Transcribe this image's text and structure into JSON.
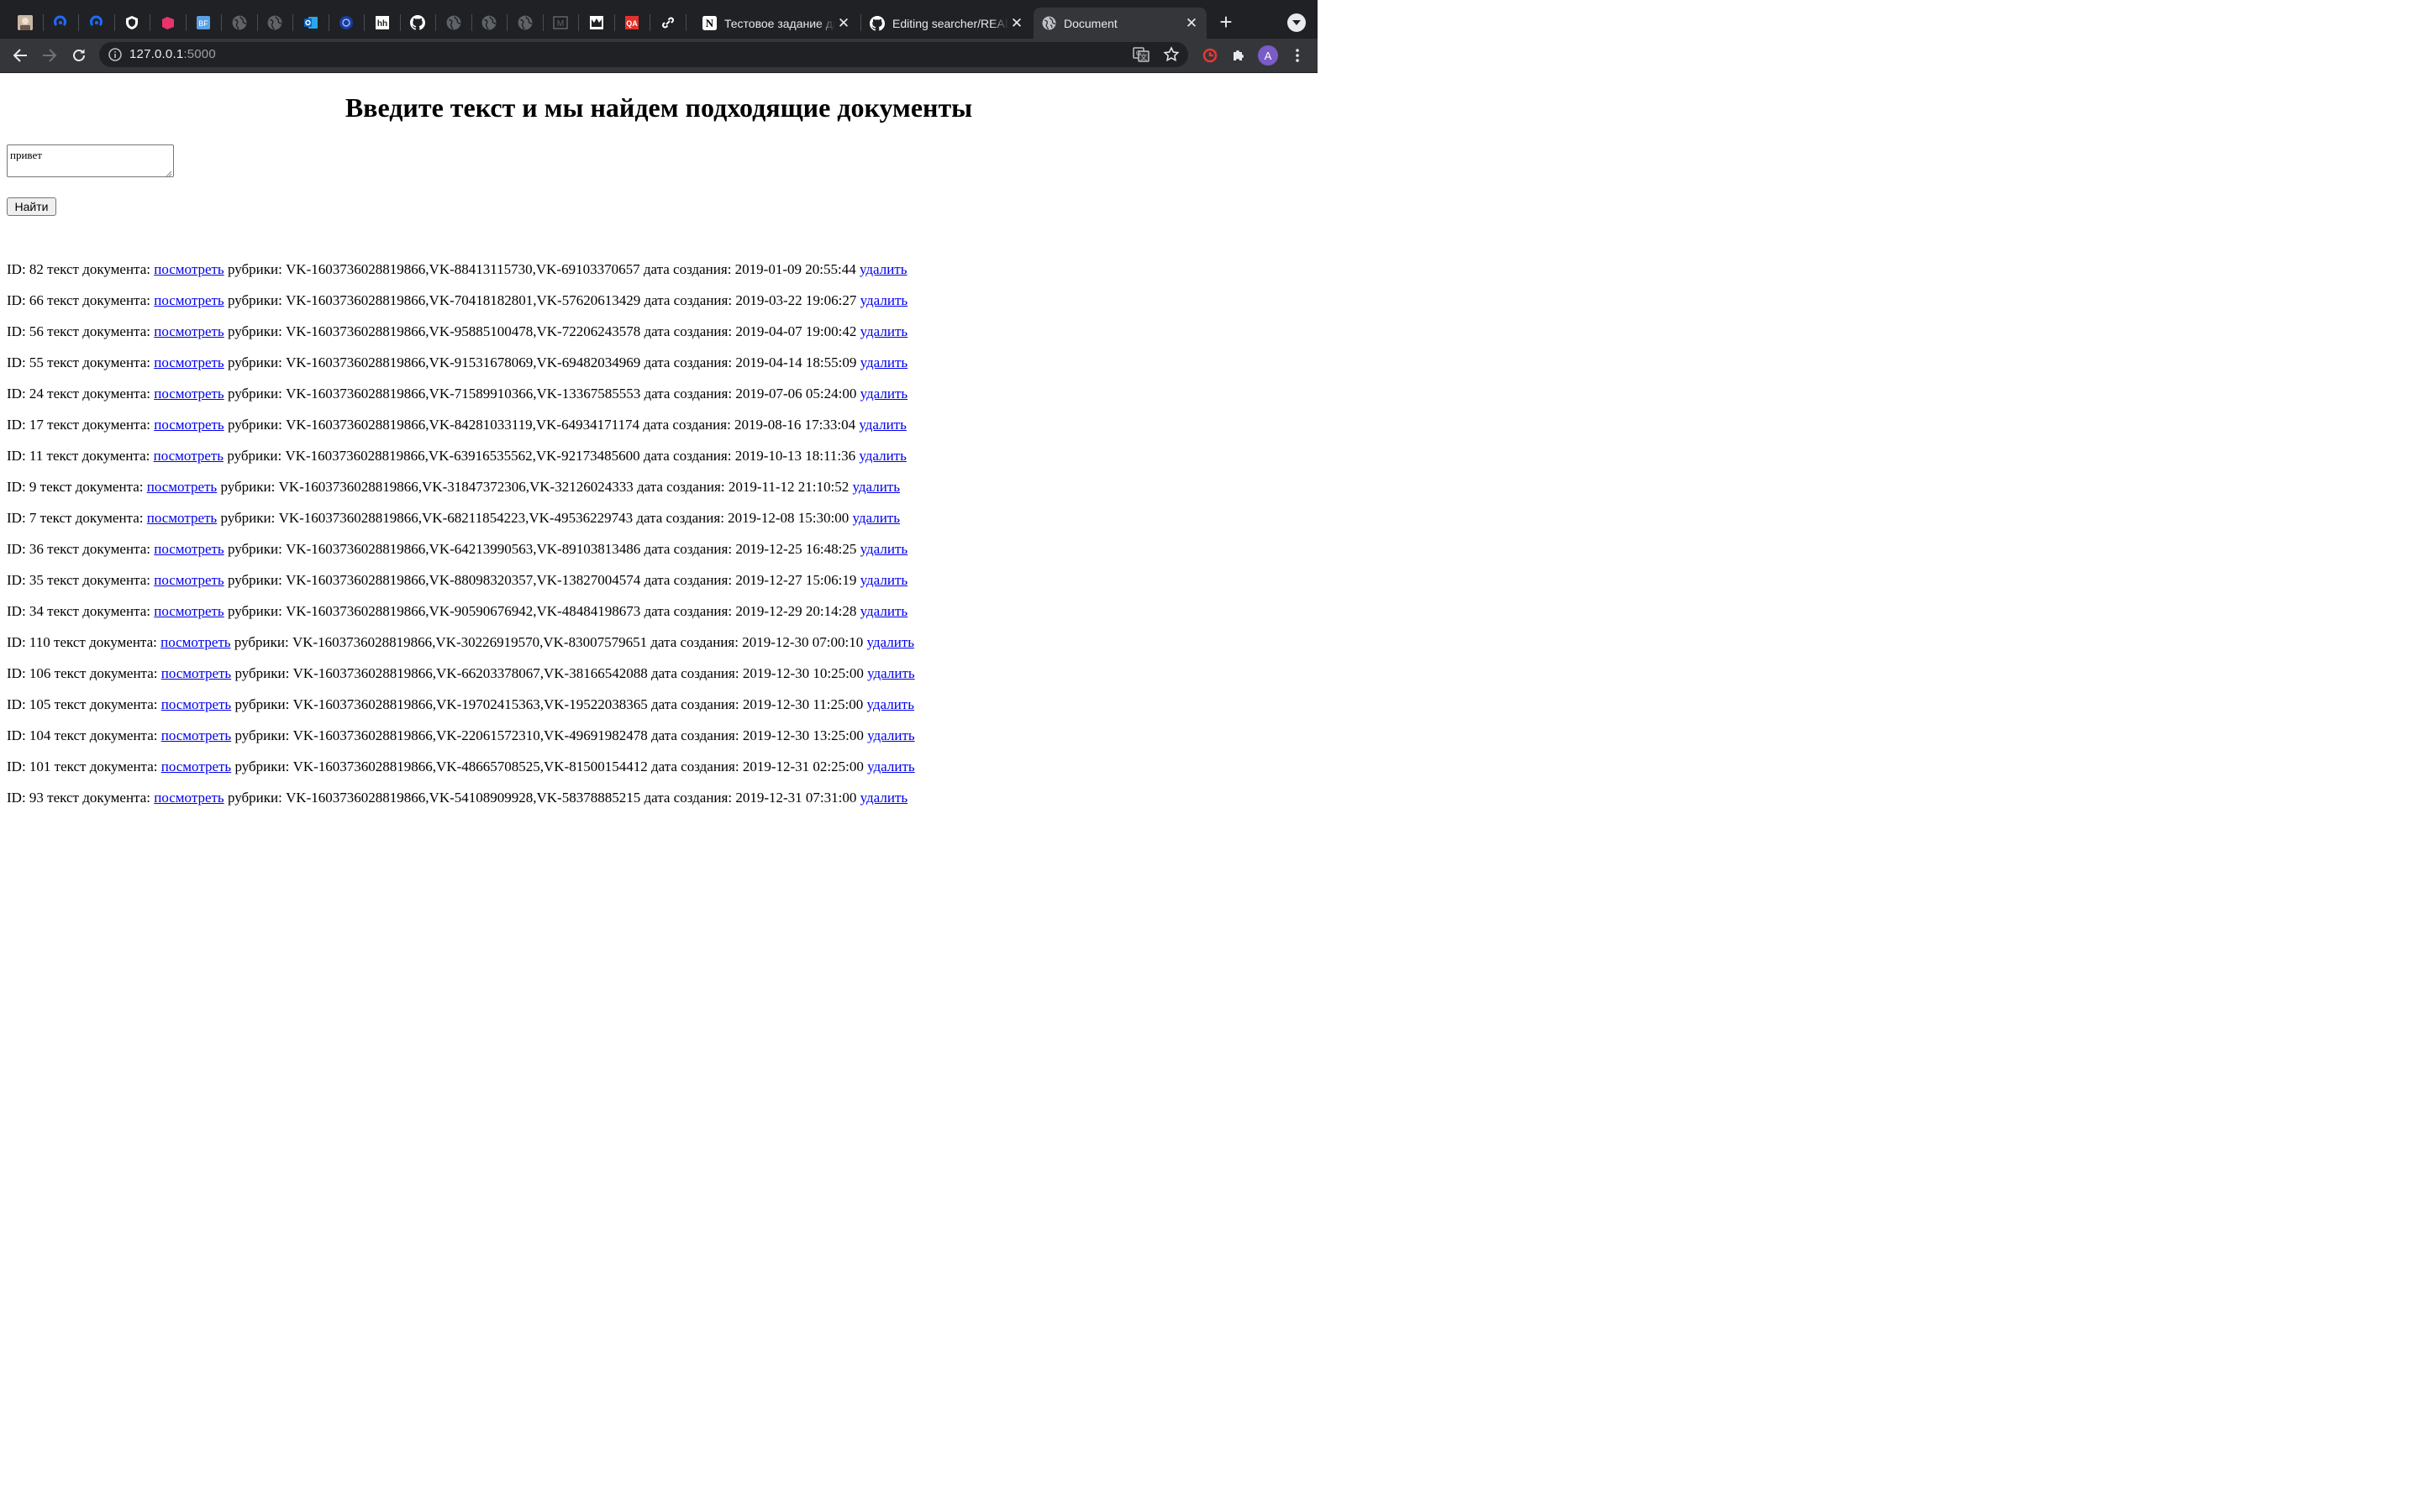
{
  "browser": {
    "pinned_tabs": [
      {
        "icon": "avatar-thumbnail-icon"
      },
      {
        "icon": "blue-loop-icon"
      },
      {
        "icon": "blue-loop-icon"
      },
      {
        "icon": "shield-icon"
      },
      {
        "icon": "pink-tag-icon"
      },
      {
        "icon": "bf-icon"
      },
      {
        "icon": "globe-icon"
      },
      {
        "icon": "globe-icon"
      },
      {
        "icon": "outlook-icon"
      },
      {
        "icon": "blue-circle-icon"
      },
      {
        "icon": "hh-icon"
      },
      {
        "icon": "github-icon"
      },
      {
        "icon": "globe-icon"
      },
      {
        "icon": "globe-icon"
      },
      {
        "icon": "globe-icon"
      },
      {
        "icon": "m-icon"
      },
      {
        "icon": "crown-icon"
      },
      {
        "icon": "qa-icon"
      },
      {
        "icon": "link-icon"
      }
    ],
    "tabs": [
      {
        "title": "Тестовое задание для",
        "icon": "notion-icon"
      },
      {
        "title": "Editing searcher/READ",
        "icon": "github-icon"
      },
      {
        "title": "Document",
        "icon": "globe-icon",
        "active": true
      }
    ],
    "qa_label": "QA",
    "bf_label": "BF",
    "hh_label": "hh",
    "m_label": "M",
    "notion_label": "N",
    "profile_initial": "A",
    "address": {
      "host": "127.0.0.1",
      "port": ":5000"
    }
  },
  "page": {
    "heading": "Введите текст и мы найдем подходящие документы",
    "query_value": "привет",
    "find_button": "Найти",
    "labels": {
      "id": "ID: ",
      "text": " текст документа: ",
      "view": "посмотреть",
      "rubrics": " рубрики: ",
      "created": " дата создания: ",
      "delete": "удалить"
    },
    "results": [
      {
        "id": "82",
        "rubrics": "VK-1603736028819866,VK-88413115730,VK-69103370657",
        "date": "2019-01-09 20:55:44"
      },
      {
        "id": "66",
        "rubrics": "VK-1603736028819866,VK-70418182801,VK-57620613429",
        "date": "2019-03-22 19:06:27"
      },
      {
        "id": "56",
        "rubrics": "VK-1603736028819866,VK-95885100478,VK-72206243578",
        "date": "2019-04-07 19:00:42"
      },
      {
        "id": "55",
        "rubrics": "VK-1603736028819866,VK-91531678069,VK-69482034969",
        "date": "2019-04-14 18:55:09"
      },
      {
        "id": "24",
        "rubrics": "VK-1603736028819866,VK-71589910366,VK-13367585553",
        "date": "2019-07-06 05:24:00"
      },
      {
        "id": "17",
        "rubrics": "VK-1603736028819866,VK-84281033119,VK-64934171174",
        "date": "2019-08-16 17:33:04"
      },
      {
        "id": "11",
        "rubrics": "VK-1603736028819866,VK-63916535562,VK-92173485600",
        "date": "2019-10-13 18:11:36"
      },
      {
        "id": "9",
        "rubrics": "VK-1603736028819866,VK-31847372306,VK-32126024333",
        "date": "2019-11-12 21:10:52"
      },
      {
        "id": "7",
        "rubrics": "VK-1603736028819866,VK-68211854223,VK-49536229743",
        "date": "2019-12-08 15:30:00"
      },
      {
        "id": "36",
        "rubrics": "VK-1603736028819866,VK-64213990563,VK-89103813486",
        "date": "2019-12-25 16:48:25"
      },
      {
        "id": "35",
        "rubrics": "VK-1603736028819866,VK-88098320357,VK-13827004574",
        "date": "2019-12-27 15:06:19"
      },
      {
        "id": "34",
        "rubrics": "VK-1603736028819866,VK-90590676942,VK-48484198673",
        "date": "2019-12-29 20:14:28"
      },
      {
        "id": "110",
        "rubrics": "VK-1603736028819866,VK-30226919570,VK-83007579651",
        "date": "2019-12-30 07:00:10"
      },
      {
        "id": "106",
        "rubrics": "VK-1603736028819866,VK-66203378067,VK-38166542088",
        "date": "2019-12-30 10:25:00"
      },
      {
        "id": "105",
        "rubrics": "VK-1603736028819866,VK-19702415363,VK-19522038365",
        "date": "2019-12-30 11:25:00"
      },
      {
        "id": "104",
        "rubrics": "VK-1603736028819866,VK-22061572310,VK-49691982478",
        "date": "2019-12-30 13:25:00"
      },
      {
        "id": "101",
        "rubrics": "VK-1603736028819866,VK-48665708525,VK-81500154412",
        "date": "2019-12-31 02:25:00"
      },
      {
        "id": "93",
        "rubrics": "VK-1603736028819866,VK-54108909928,VK-58378885215",
        "date": "2019-12-31 07:31:00"
      }
    ]
  }
}
